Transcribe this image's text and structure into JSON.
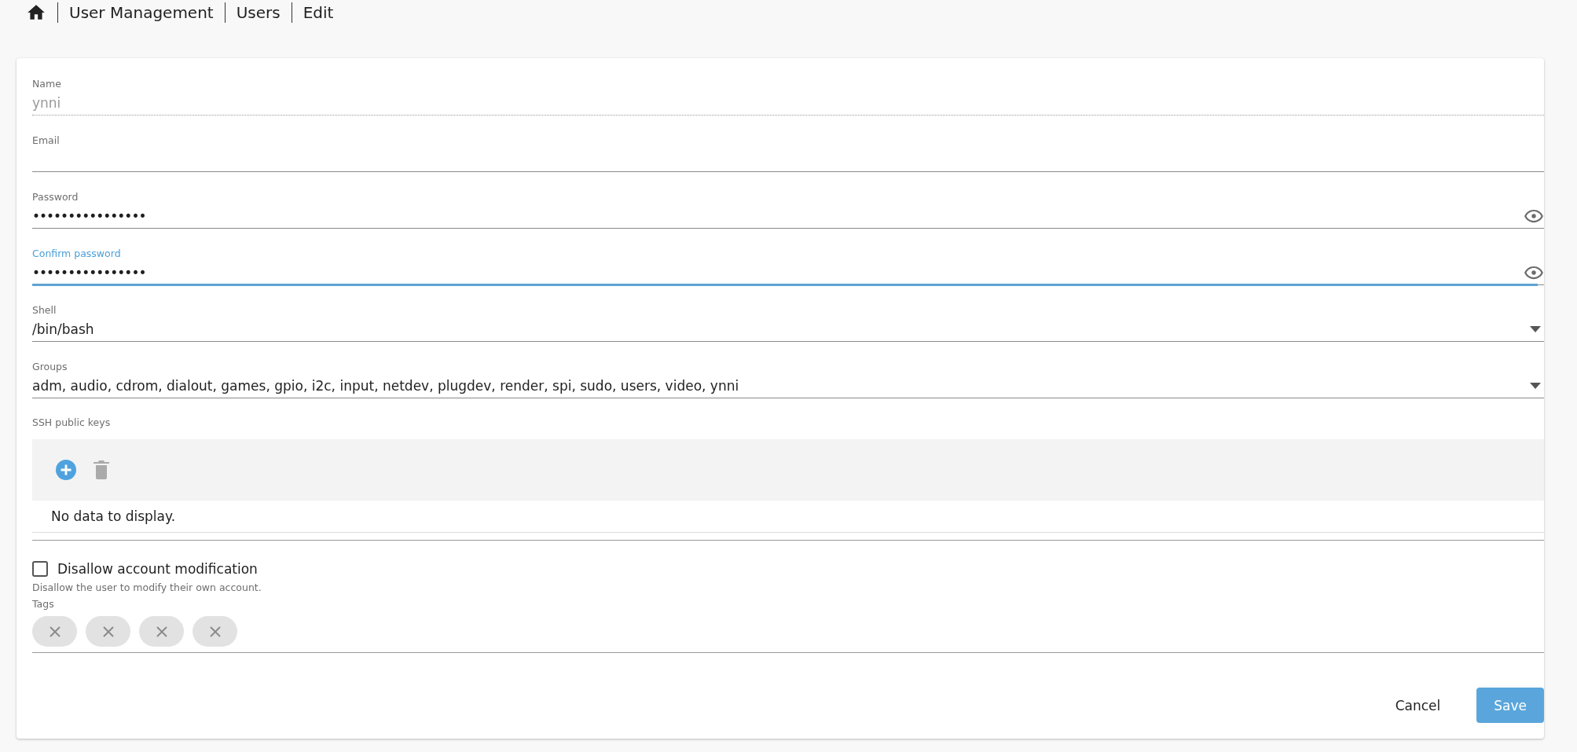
{
  "breadcrumb": [
    "User Management",
    "Users",
    "Edit"
  ],
  "fields": [
    {
      "kind": "text",
      "label": "Name",
      "value": "ynni",
      "disabled": true,
      "focused": false
    },
    {
      "kind": "text",
      "label": "Email",
      "disabled": false,
      "focused": false
    },
    {
      "kind": "password",
      "label": "Password",
      "value": "••••••••••••••••",
      "disabled": false,
      "focused": false
    },
    {
      "kind": "password",
      "label": "Confirm password",
      "value": "••••••••••••••••",
      "disabled": false,
      "focused": true
    },
    {
      "kind": "select",
      "label": "Shell",
      "value": "/bin/bash",
      "disabled": false,
      "focused": false
    },
    {
      "kind": "select",
      "label": "Groups",
      "value": "adm, audio, cdrom, dialout, games, gpio, i2c, input, netdev, plugdev, render, spi, sudo, users, video, ynni",
      "disabled": false,
      "focused": false
    }
  ],
  "ssh_keys": {
    "label": "SSH public keys",
    "empty_text": "No data to display."
  },
  "disallow_modification": {
    "label": "Disallow account modification",
    "checked": false,
    "hint": "Disallow the user to modify their own account."
  },
  "tags": {
    "label": "Tags",
    "chips": [
      {
        "kind": "removable"
      },
      {
        "kind": "removable"
      },
      {
        "kind": "removable"
      },
      {
        "kind": "removable"
      }
    ]
  },
  "buttons": [
    {
      "kind": "flat",
      "label": "Cancel"
    },
    {
      "kind": "primary",
      "label": "Save"
    }
  ]
}
